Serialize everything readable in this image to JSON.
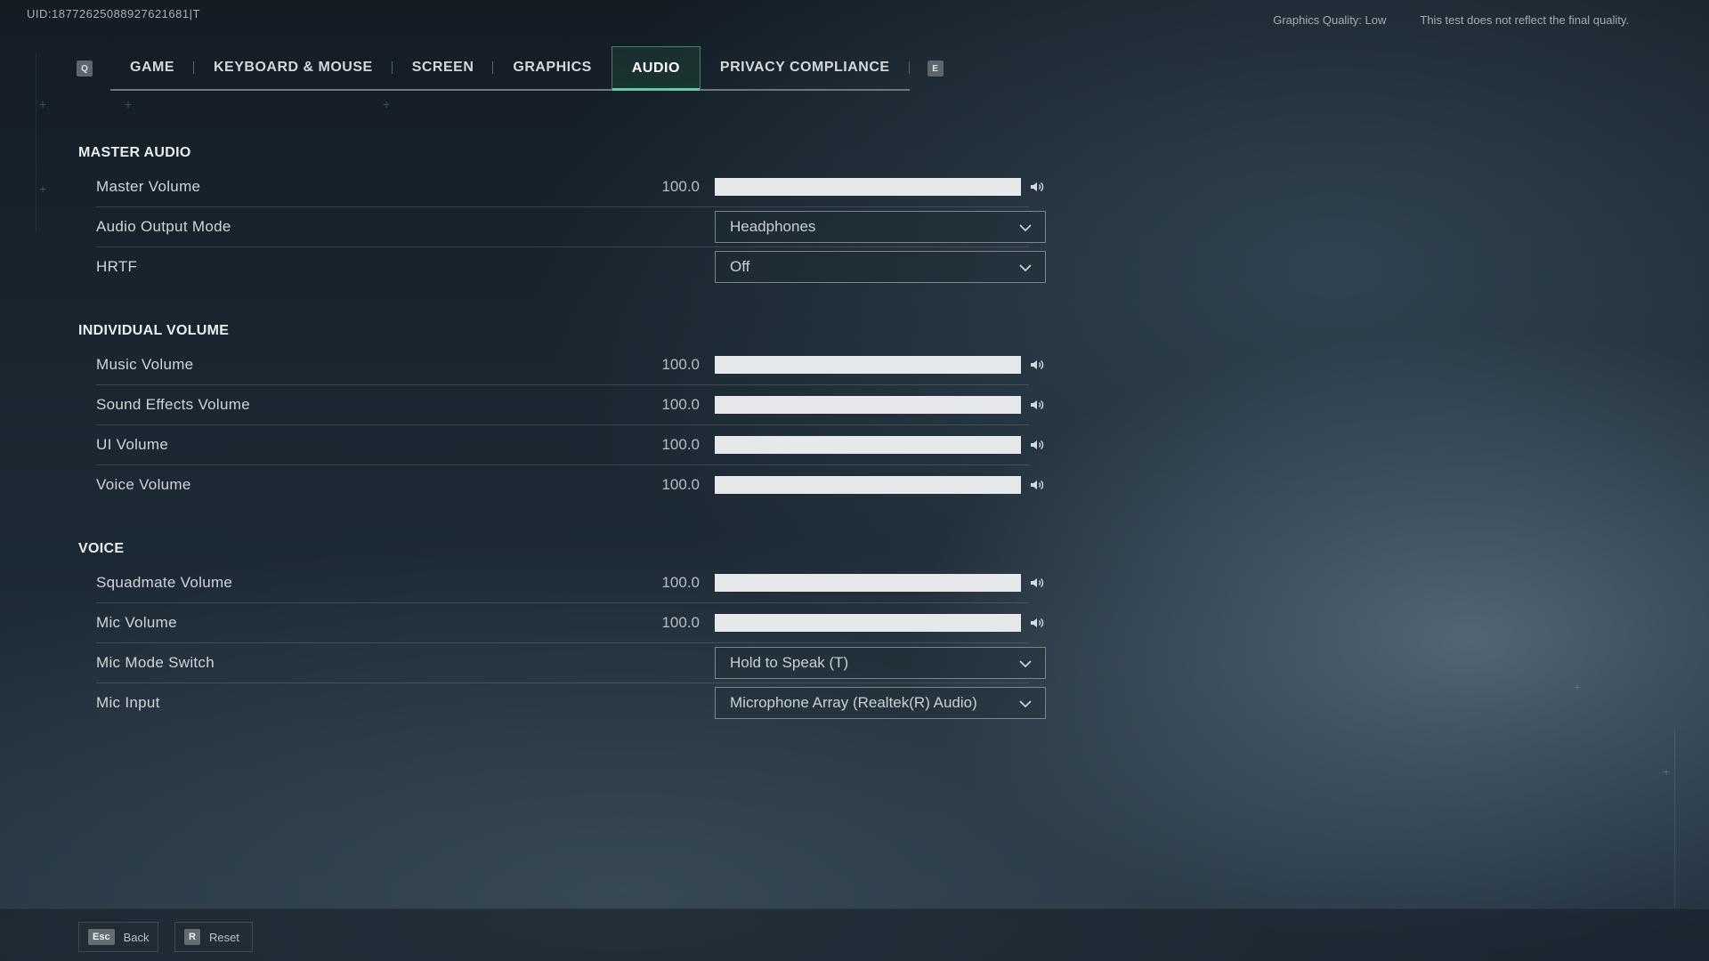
{
  "header": {
    "uid": "UID:18772625088927621681|T",
    "graphics_quality": "Graphics Quality: Low",
    "notice": "This test does not reflect the final quality."
  },
  "tabs": {
    "prev_key": "Q",
    "next_key": "E",
    "items": [
      {
        "label": "GAME"
      },
      {
        "label": "KEYBOARD & MOUSE"
      },
      {
        "label": "SCREEN"
      },
      {
        "label": "GRAPHICS"
      },
      {
        "label": "AUDIO",
        "active": true
      },
      {
        "label": "PRIVACY COMPLIANCE"
      }
    ]
  },
  "sections": [
    {
      "title": "MASTER AUDIO",
      "rows": [
        {
          "label": "Master Volume",
          "type": "slider",
          "value": "100.0",
          "level": 100
        },
        {
          "label": "Audio Output Mode",
          "type": "dropdown",
          "selected": "Headphones"
        },
        {
          "label": "HRTF",
          "type": "dropdown",
          "selected": "Off"
        }
      ]
    },
    {
      "title": "INDIVIDUAL VOLUME",
      "rows": [
        {
          "label": "Music Volume",
          "type": "slider",
          "value": "100.0",
          "level": 100
        },
        {
          "label": "Sound Effects Volume",
          "type": "slider",
          "value": "100.0",
          "level": 100
        },
        {
          "label": "UI Volume",
          "type": "slider",
          "value": "100.0",
          "level": 100
        },
        {
          "label": "Voice Volume",
          "type": "slider",
          "value": "100.0",
          "level": 100
        }
      ]
    },
    {
      "title": "VOICE",
      "rows": [
        {
          "label": "Squadmate Volume",
          "type": "slider",
          "value": "100.0",
          "level": 100
        },
        {
          "label": "Mic Volume",
          "type": "slider",
          "value": "100.0",
          "level": 100
        },
        {
          "label": "Mic Mode Switch",
          "type": "dropdown",
          "selected": "Hold to Speak (T)"
        },
        {
          "label": "Mic Input",
          "type": "dropdown",
          "selected": "Microphone Array (Realtek(R) Audio)"
        }
      ]
    }
  ],
  "footer": {
    "back_key": "Esc",
    "back_label": "Back",
    "reset_key": "R",
    "reset_label": "Reset"
  },
  "colors": {
    "accent": "#4fd6a0",
    "slider_fill": "#e6e8e9"
  },
  "icons": {
    "slider_end": "speaker-icon",
    "dropdown": "chevron-down-icon"
  }
}
